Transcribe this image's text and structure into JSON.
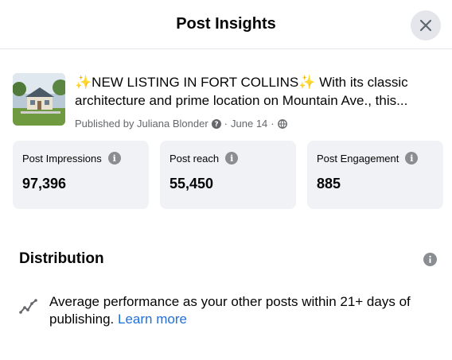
{
  "dialog": {
    "title": "Post Insights",
    "close_icon": "close-icon"
  },
  "post": {
    "text": "✨NEW LISTING IN FORT COLLINS✨ With its classic architecture and prime location on Mountain Ave., this...",
    "meta_prefix": "Published by Juliana Blonder",
    "meta_date": "June 14",
    "meta_sep": "·",
    "thumbnail_icon": "house-photo-thumbnail"
  },
  "metrics": [
    {
      "label": "Post Impressions",
      "value": "97,396"
    },
    {
      "label": "Post reach",
      "value": "55,450"
    },
    {
      "label": "Post Engagement",
      "value": "885"
    }
  ],
  "distribution": {
    "title": "Distribution",
    "text": "Average performance as your other posts within 21+ days of publishing.",
    "link": "Learn more"
  },
  "colors": {
    "link": "#216fdb",
    "card_bg": "#f0f2f5",
    "secondary_text": "#65676b",
    "icon_gray": "#8a8d91"
  }
}
